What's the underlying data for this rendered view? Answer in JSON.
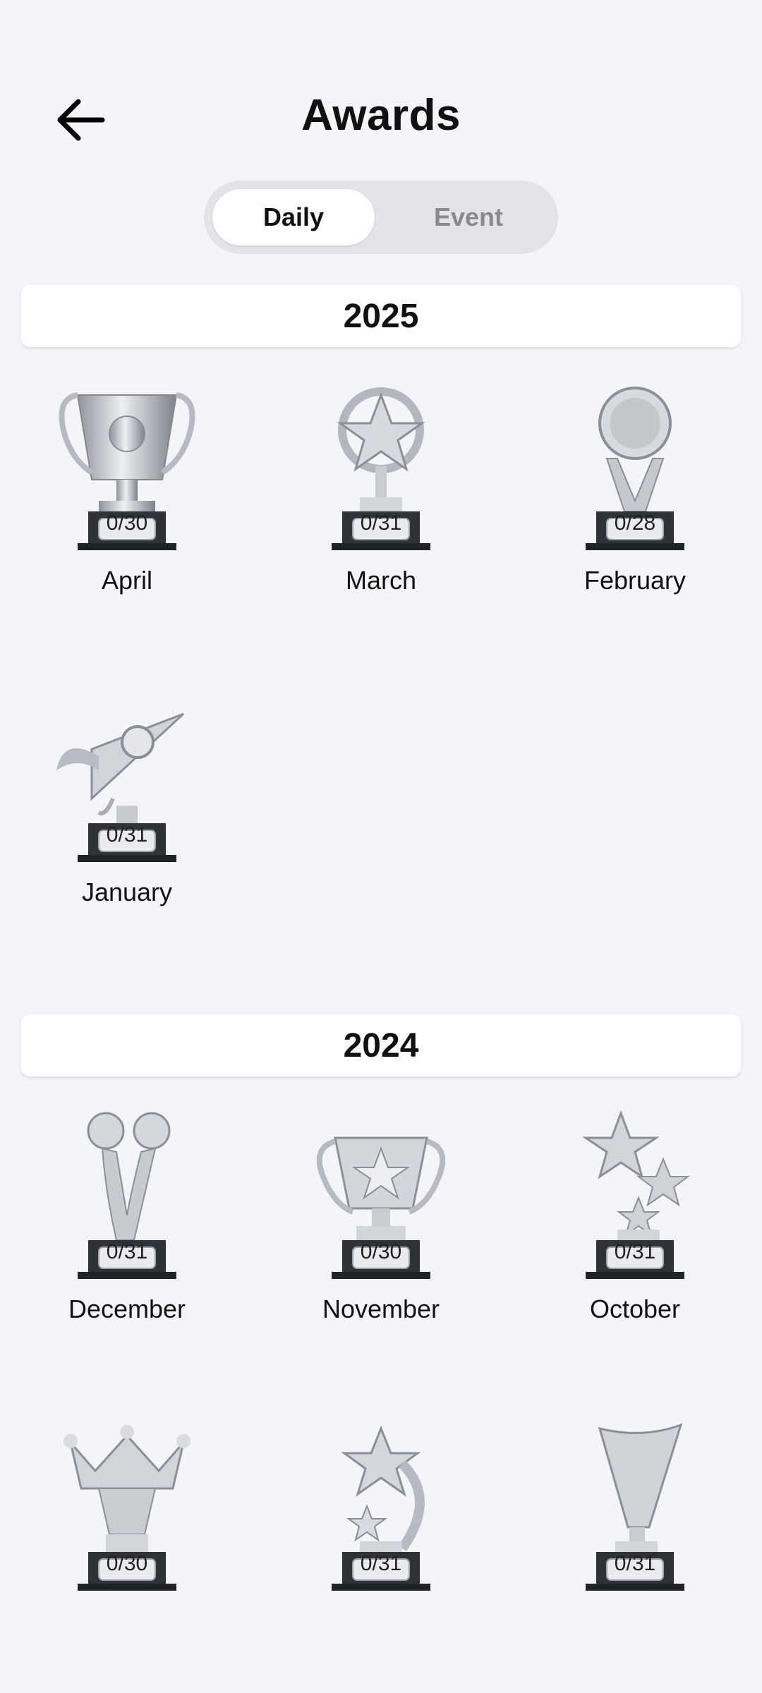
{
  "header": {
    "title": "Awards",
    "back_icon": "arrow-left-icon"
  },
  "tabs": [
    {
      "label": "Daily",
      "selected": true
    },
    {
      "label": "Event",
      "selected": false
    }
  ],
  "sections": [
    {
      "year": "2025",
      "awards": [
        {
          "label": "April",
          "count": "0/30",
          "icon": "cup-trophy-icon"
        },
        {
          "label": "March",
          "count": "0/31",
          "icon": "star-ring-trophy-icon"
        },
        {
          "label": "February",
          "count": "0/28",
          "icon": "disc-trophy-icon"
        },
        {
          "label": "January",
          "count": "0/31",
          "icon": "rocket-trophy-icon"
        }
      ]
    },
    {
      "year": "2024",
      "awards": [
        {
          "label": "December",
          "count": "0/31",
          "icon": "twin-ball-trophy-icon"
        },
        {
          "label": "November",
          "count": "0/30",
          "icon": "star-cup-trophy-icon"
        },
        {
          "label": "October",
          "count": "0/31",
          "icon": "three-stars-trophy-icon"
        },
        {
          "label": "",
          "count": "0/30",
          "icon": "crown-trophy-icon"
        },
        {
          "label": "",
          "count": "0/31",
          "icon": "shooting-star-trophy-icon"
        },
        {
          "label": "",
          "count": "0/31",
          "icon": "flute-trophy-icon"
        }
      ]
    }
  ],
  "colors": {
    "background": "#f3f5f9",
    "silver": "#c9ccd1",
    "base": "#2b2f34"
  }
}
